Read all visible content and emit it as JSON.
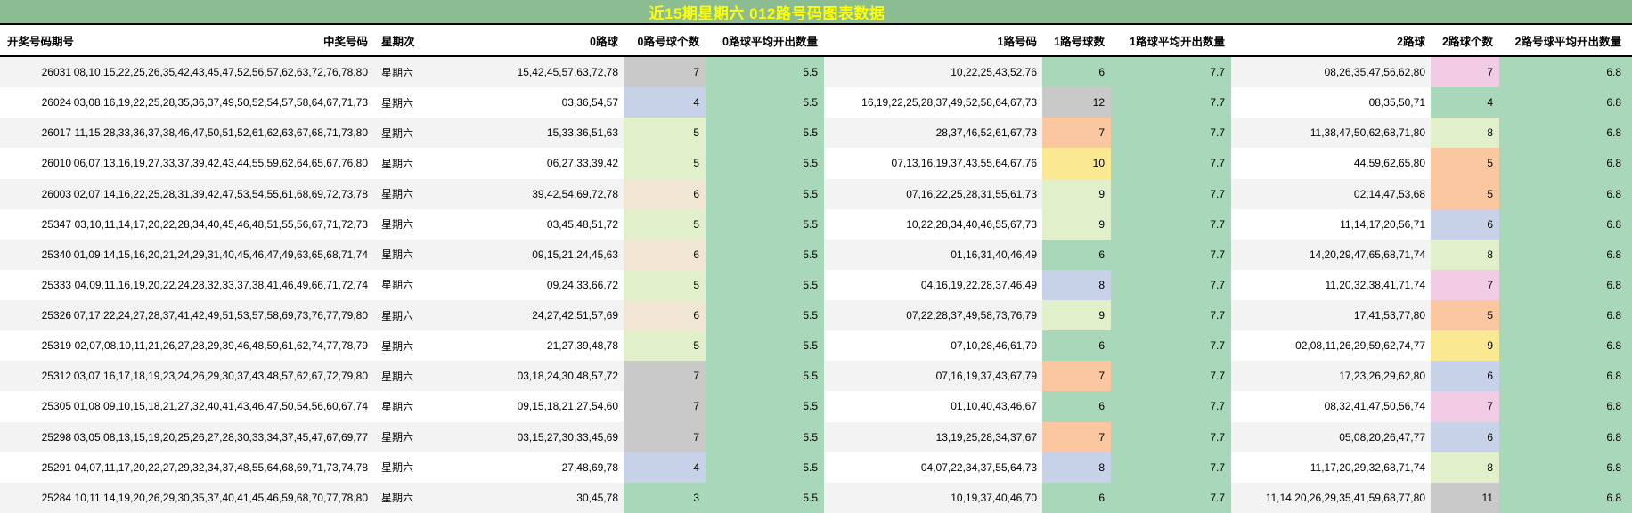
{
  "title": "近15期星期六 012路号码图表数据",
  "colors": {
    "title_bg": "#8cbd92",
    "title_text": "#ffff00",
    "stripe_gray": "#f3f3f3",
    "avg_green": "#a8d8b9",
    "count_green": "#a8d8b9",
    "count_gray": "#c9c9c9",
    "count_lavender": "#c7d1e7",
    "count_palegreen": "#e2efcb",
    "count_tan": "#f1e5d3",
    "count_orange": "#fbc7a0",
    "count_yellow": "#fae893",
    "count_pink": "#f2cbe5"
  },
  "table": {
    "headers": [
      "开奖号码期号",
      "中奖号码",
      "星期次",
      "0路球",
      "0路号球个数",
      "0路球平均开出数量",
      "1路号码",
      "1路号球数",
      "1路球平均开出数量",
      "2路球",
      "2路球个数",
      "2路号球平均开出数量"
    ],
    "rows": [
      {
        "period": "26031",
        "winning_numbers": "08,10,15,22,25,26,35,42,43,45,47,52,56,57,62,63,72,76,78,80",
        "weekday": "星期六",
        "road0": {
          "numbers": "15,42,45,57,63,72,78",
          "count": "7",
          "count_color": "gray",
          "average": "5.5"
        },
        "road1": {
          "numbers": "10,22,25,43,52,76",
          "count": "6",
          "count_color": "green",
          "average": "7.7"
        },
        "road2": {
          "numbers": "08,26,35,47,56,62,80",
          "count": "7",
          "count_color": "pink",
          "average": "6.8"
        }
      },
      {
        "period": "26024",
        "winning_numbers": "03,08,16,19,22,25,28,35,36,37,49,50,52,54,57,58,64,67,71,73",
        "weekday": "星期六",
        "road0": {
          "numbers": "03,36,54,57",
          "count": "4",
          "count_color": "lavender",
          "average": "5.5"
        },
        "road1": {
          "numbers": "16,19,22,25,28,37,49,52,58,64,67,73",
          "count": "12",
          "count_color": "gray",
          "average": "7.7"
        },
        "road2": {
          "numbers": "08,35,50,71",
          "count": "4",
          "count_color": "green",
          "average": "6.8"
        }
      },
      {
        "period": "26017",
        "winning_numbers": "11,15,28,33,36,37,38,46,47,50,51,52,61,62,63,67,68,71,73,80",
        "weekday": "星期六",
        "road0": {
          "numbers": "15,33,36,51,63",
          "count": "5",
          "count_color": "palegreen",
          "average": "5.5"
        },
        "road1": {
          "numbers": "28,37,46,52,61,67,73",
          "count": "7",
          "count_color": "orange",
          "average": "7.7"
        },
        "road2": {
          "numbers": "11,38,47,50,62,68,71,80",
          "count": "8",
          "count_color": "palegreen",
          "average": "6.8"
        }
      },
      {
        "period": "26010",
        "winning_numbers": "06,07,13,16,19,27,33,37,39,42,43,44,55,59,62,64,65,67,76,80",
        "weekday": "星期六",
        "road0": {
          "numbers": "06,27,33,39,42",
          "count": "5",
          "count_color": "palegreen",
          "average": "5.5"
        },
        "road1": {
          "numbers": "07,13,16,19,37,43,55,64,67,76",
          "count": "10",
          "count_color": "yellow",
          "average": "7.7"
        },
        "road2": {
          "numbers": "44,59,62,65,80",
          "count": "5",
          "count_color": "orange",
          "average": "6.8"
        }
      },
      {
        "period": "26003",
        "winning_numbers": "02,07,14,16,22,25,28,31,39,42,47,53,54,55,61,68,69,72,73,78",
        "weekday": "星期六",
        "road0": {
          "numbers": "39,42,54,69,72,78",
          "count": "6",
          "count_color": "tan",
          "average": "5.5"
        },
        "road1": {
          "numbers": "07,16,22,25,28,31,55,61,73",
          "count": "9",
          "count_color": "palegreen",
          "average": "7.7"
        },
        "road2": {
          "numbers": "02,14,47,53,68",
          "count": "5",
          "count_color": "orange",
          "average": "6.8"
        }
      },
      {
        "period": "25347",
        "winning_numbers": "03,10,11,14,17,20,22,28,34,40,45,46,48,51,55,56,67,71,72,73",
        "weekday": "星期六",
        "road0": {
          "numbers": "03,45,48,51,72",
          "count": "5",
          "count_color": "palegreen",
          "average": "5.5"
        },
        "road1": {
          "numbers": "10,22,28,34,40,46,55,67,73",
          "count": "9",
          "count_color": "palegreen",
          "average": "7.7"
        },
        "road2": {
          "numbers": "11,14,17,20,56,71",
          "count": "6",
          "count_color": "lavender",
          "average": "6.8"
        }
      },
      {
        "period": "25340",
        "winning_numbers": "01,09,14,15,16,20,21,24,29,31,40,45,46,47,49,63,65,68,71,74",
        "weekday": "星期六",
        "road0": {
          "numbers": "09,15,21,24,45,63",
          "count": "6",
          "count_color": "tan",
          "average": "5.5"
        },
        "road1": {
          "numbers": "01,16,31,40,46,49",
          "count": "6",
          "count_color": "green",
          "average": "7.7"
        },
        "road2": {
          "numbers": "14,20,29,47,65,68,71,74",
          "count": "8",
          "count_color": "palegreen",
          "average": "6.8"
        }
      },
      {
        "period": "25333",
        "winning_numbers": "04,09,11,16,19,20,22,24,28,32,33,37,38,41,46,49,66,71,72,74",
        "weekday": "星期六",
        "road0": {
          "numbers": "09,24,33,66,72",
          "count": "5",
          "count_color": "palegreen",
          "average": "5.5"
        },
        "road1": {
          "numbers": "04,16,19,22,28,37,46,49",
          "count": "8",
          "count_color": "lavender",
          "average": "7.7"
        },
        "road2": {
          "numbers": "11,20,32,38,41,71,74",
          "count": "7",
          "count_color": "pink",
          "average": "6.8"
        }
      },
      {
        "period": "25326",
        "winning_numbers": "07,17,22,24,27,28,37,41,42,49,51,53,57,58,69,73,76,77,79,80",
        "weekday": "星期六",
        "road0": {
          "numbers": "24,27,42,51,57,69",
          "count": "6",
          "count_color": "tan",
          "average": "5.5"
        },
        "road1": {
          "numbers": "07,22,28,37,49,58,73,76,79",
          "count": "9",
          "count_color": "palegreen",
          "average": "7.7"
        },
        "road2": {
          "numbers": "17,41,53,77,80",
          "count": "5",
          "count_color": "orange",
          "average": "6.8"
        }
      },
      {
        "period": "25319",
        "winning_numbers": "02,07,08,10,11,21,26,27,28,29,39,46,48,59,61,62,74,77,78,79",
        "weekday": "星期六",
        "road0": {
          "numbers": "21,27,39,48,78",
          "count": "5",
          "count_color": "palegreen",
          "average": "5.5"
        },
        "road1": {
          "numbers": "07,10,28,46,61,79",
          "count": "6",
          "count_color": "green",
          "average": "7.7"
        },
        "road2": {
          "numbers": "02,08,11,26,29,59,62,74,77",
          "count": "9",
          "count_color": "yellow",
          "average": "6.8"
        }
      },
      {
        "period": "25312",
        "winning_numbers": "03,07,16,17,18,19,23,24,26,29,30,37,43,48,57,62,67,72,79,80",
        "weekday": "星期六",
        "road0": {
          "numbers": "03,18,24,30,48,57,72",
          "count": "7",
          "count_color": "gray",
          "average": "5.5"
        },
        "road1": {
          "numbers": "07,16,19,37,43,67,79",
          "count": "7",
          "count_color": "orange",
          "average": "7.7"
        },
        "road2": {
          "numbers": "17,23,26,29,62,80",
          "count": "6",
          "count_color": "lavender",
          "average": "6.8"
        }
      },
      {
        "period": "25305",
        "winning_numbers": "01,08,09,10,15,18,21,27,32,40,41,43,46,47,50,54,56,60,67,74",
        "weekday": "星期六",
        "road0": {
          "numbers": "09,15,18,21,27,54,60",
          "count": "7",
          "count_color": "gray",
          "average": "5.5"
        },
        "road1": {
          "numbers": "01,10,40,43,46,67",
          "count": "6",
          "count_color": "green",
          "average": "7.7"
        },
        "road2": {
          "numbers": "08,32,41,47,50,56,74",
          "count": "7",
          "count_color": "pink",
          "average": "6.8"
        }
      },
      {
        "period": "25298",
        "winning_numbers": "03,05,08,13,15,19,20,25,26,27,28,30,33,34,37,45,47,67,69,77",
        "weekday": "星期六",
        "road0": {
          "numbers": "03,15,27,30,33,45,69",
          "count": "7",
          "count_color": "gray",
          "average": "5.5"
        },
        "road1": {
          "numbers": "13,19,25,28,34,37,67",
          "count": "7",
          "count_color": "orange",
          "average": "7.7"
        },
        "road2": {
          "numbers": "05,08,20,26,47,77",
          "count": "6",
          "count_color": "lavender",
          "average": "6.8"
        }
      },
      {
        "period": "25291",
        "winning_numbers": "04,07,11,17,20,22,27,29,32,34,37,48,55,64,68,69,71,73,74,78",
        "weekday": "星期六",
        "road0": {
          "numbers": "27,48,69,78",
          "count": "4",
          "count_color": "lavender",
          "average": "5.5"
        },
        "road1": {
          "numbers": "04,07,22,34,37,55,64,73",
          "count": "8",
          "count_color": "lavender",
          "average": "7.7"
        },
        "road2": {
          "numbers": "11,17,20,29,32,68,71,74",
          "count": "8",
          "count_color": "palegreen",
          "average": "6.8"
        }
      },
      {
        "period": "25284",
        "winning_numbers": "10,11,14,19,20,26,29,30,35,37,40,41,45,46,59,68,70,77,78,80",
        "weekday": "星期六",
        "road0": {
          "numbers": "30,45,78",
          "count": "3",
          "count_color": "green",
          "average": "5.5"
        },
        "road1": {
          "numbers": "10,19,37,40,46,70",
          "count": "6",
          "count_color": "green",
          "average": "7.7"
        },
        "road2": {
          "numbers": "11,14,20,26,29,35,41,59,68,77,80",
          "count": "11",
          "count_color": "gray",
          "average": "6.8"
        }
      }
    ]
  }
}
